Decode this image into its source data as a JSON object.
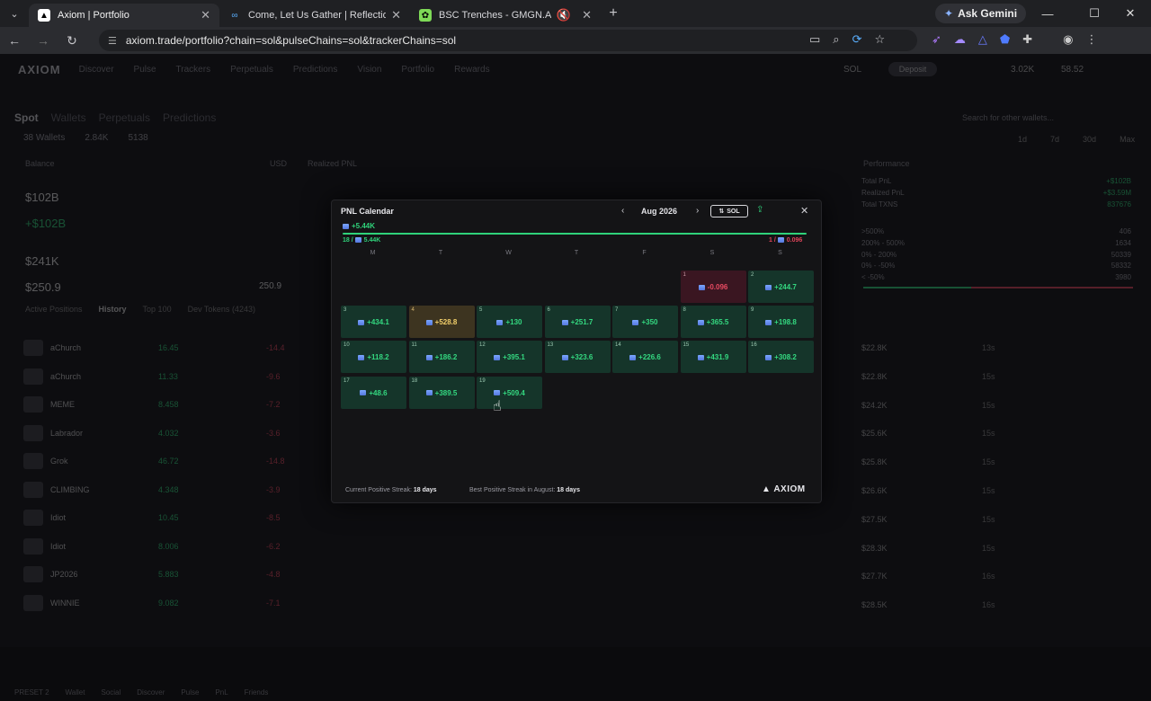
{
  "browser": {
    "tabs": [
      {
        "title": "Axiom | Portfolio",
        "active": true
      },
      {
        "title": "Come, Let Us Gather | Reflectio",
        "active": false
      },
      {
        "title": "BSC Trenches - GMGN.AI | T",
        "active": false
      }
    ],
    "gemini_label": "Ask Gemini",
    "url": "axiom.trade/portfolio?chain=sol&pulseChains=sol&trackerChains=sol"
  },
  "app": {
    "logo": "AXIOM",
    "nav": [
      "Discover",
      "Pulse",
      "Trackers",
      "Perpetuals",
      "Predictions",
      "Vision",
      "Portfolio",
      "Rewards"
    ],
    "chain": "SOL",
    "deposit": "Deposit",
    "bal_a": "3.02K",
    "bal_b": "58.52",
    "subtabs": [
      "Spot",
      "Wallets",
      "Perpetuals",
      "Predictions"
    ],
    "wallets": "38 Wallets",
    "wallet_val_a": "2.84K",
    "wallet_val_b": "5138",
    "search_placeholder": "Search for other wallets...",
    "ranges": [
      "1d",
      "7d",
      "30d",
      "Max"
    ],
    "balance_title": "Balance",
    "usd": "USD",
    "realized_title": "Realized PNL",
    "performance_title": "Performance",
    "big_value": "$102B",
    "big_value_green": "+$102B",
    "val_241k": "$241K",
    "val_250": "$250.9",
    "val_250b": "250.9",
    "list_tabs": [
      "Active Positions",
      "History",
      "Top 100",
      "Dev Tokens (4243)"
    ],
    "rows": [
      {
        "name": "aChurch",
        "v1": "16.45",
        "v2": "-14.4"
      },
      {
        "name": "aChurch",
        "v1": "11.33",
        "v2": "-9.6"
      },
      {
        "name": "MEME",
        "v1": "8.458",
        "v2": "-7.2"
      },
      {
        "name": "Labrador",
        "v1": "4.032",
        "v2": "-3.6"
      },
      {
        "name": "Grok",
        "v1": "46.72",
        "v2": "-14.8"
      },
      {
        "name": "CLIMBING",
        "v1": "4.348",
        "v2": "-3.9"
      },
      {
        "name": "Idiot",
        "v1": "10.45",
        "v2": "-8.5"
      },
      {
        "name": "Idiot",
        "v1": "8.006",
        "v2": "-6.2"
      },
      {
        "name": "JP2026",
        "v1": "5.883",
        "v2": "-4.8"
      },
      {
        "name": "WINNIE",
        "v1": "9.082",
        "v2": "-7.1"
      }
    ],
    "perf_rows": [
      {
        "k": "Total PnL",
        "v": "+$102B"
      },
      {
        "k": "Realized PnL",
        "v": "+$3.59M"
      },
      {
        "k": "Total TXNS",
        "v": "837676"
      }
    ],
    "bucket_rows": [
      {
        "k": ">500%",
        "v": "406"
      },
      {
        "k": "200% - 500%",
        "v": "1634"
      },
      {
        "k": "0% - 200%",
        "v": "50339"
      },
      {
        "k": "0% - -50%",
        "v": "58332"
      },
      {
        "k": "< -50%",
        "v": "3980"
      }
    ],
    "mcaps": [
      "$22.8K",
      "$22.8K",
      "$24.2K",
      "$25.6K",
      "$25.8K",
      "$26.6K",
      "$27.5K",
      "$28.3K",
      "$27.7K",
      "$28.5K"
    ],
    "secs": [
      "13s",
      "15s",
      "15s",
      "15s",
      "15s",
      "15s",
      "15s",
      "15s",
      "16s",
      "16s"
    ],
    "bottom": [
      "PRESET 2",
      "Wallet",
      "Social",
      "Discover",
      "Pulse",
      "PnL",
      "Friends"
    ]
  },
  "modal": {
    "title": "PNL Calendar",
    "month": "Aug 2026",
    "currency_toggle": "SOL",
    "total": "+5.44K",
    "positive_days": "18 /",
    "positive_total": "5.44K",
    "negative_days": "1 /",
    "negative_total": "0.096",
    "weekdays": [
      "M",
      "T",
      "W",
      "T",
      "F",
      "S",
      "S"
    ],
    "days": [
      {
        "day": "1",
        "value": "-0.096",
        "tone": "neg"
      },
      {
        "day": "2",
        "value": "+244.7",
        "tone": "pos"
      },
      {
        "day": "3",
        "value": "+434.1",
        "tone": "pos"
      },
      {
        "day": "4",
        "value": "+528.8",
        "tone": "hot"
      },
      {
        "day": "5",
        "value": "+130",
        "tone": "pos"
      },
      {
        "day": "6",
        "value": "+251.7",
        "tone": "pos"
      },
      {
        "day": "7",
        "value": "+350",
        "tone": "pos"
      },
      {
        "day": "8",
        "value": "+365.5",
        "tone": "pos"
      },
      {
        "day": "9",
        "value": "+198.8",
        "tone": "pos"
      },
      {
        "day": "10",
        "value": "+118.2",
        "tone": "pos"
      },
      {
        "day": "11",
        "value": "+186.2",
        "tone": "pos"
      },
      {
        "day": "12",
        "value": "+395.1",
        "tone": "pos"
      },
      {
        "day": "13",
        "value": "+323.6",
        "tone": "pos"
      },
      {
        "day": "14",
        "value": "+226.6",
        "tone": "pos"
      },
      {
        "day": "15",
        "value": "+431.9",
        "tone": "pos"
      },
      {
        "day": "16",
        "value": "+308.2",
        "tone": "pos"
      },
      {
        "day": "17",
        "value": "+48.6",
        "tone": "pos"
      },
      {
        "day": "18",
        "value": "+389.5",
        "tone": "pos"
      },
      {
        "day": "19",
        "value": "+509.4",
        "tone": "pos"
      }
    ],
    "current_streak_label": "Current Positive Streak:",
    "current_streak": "18 days",
    "best_streak_label": "Best Positive Streak in August:",
    "best_streak": "18 days",
    "logo": "AXIOM"
  },
  "colors": {
    "positive": "#2fd27a",
    "negative": "#e0445a",
    "highlight": "#f2cf6a"
  }
}
